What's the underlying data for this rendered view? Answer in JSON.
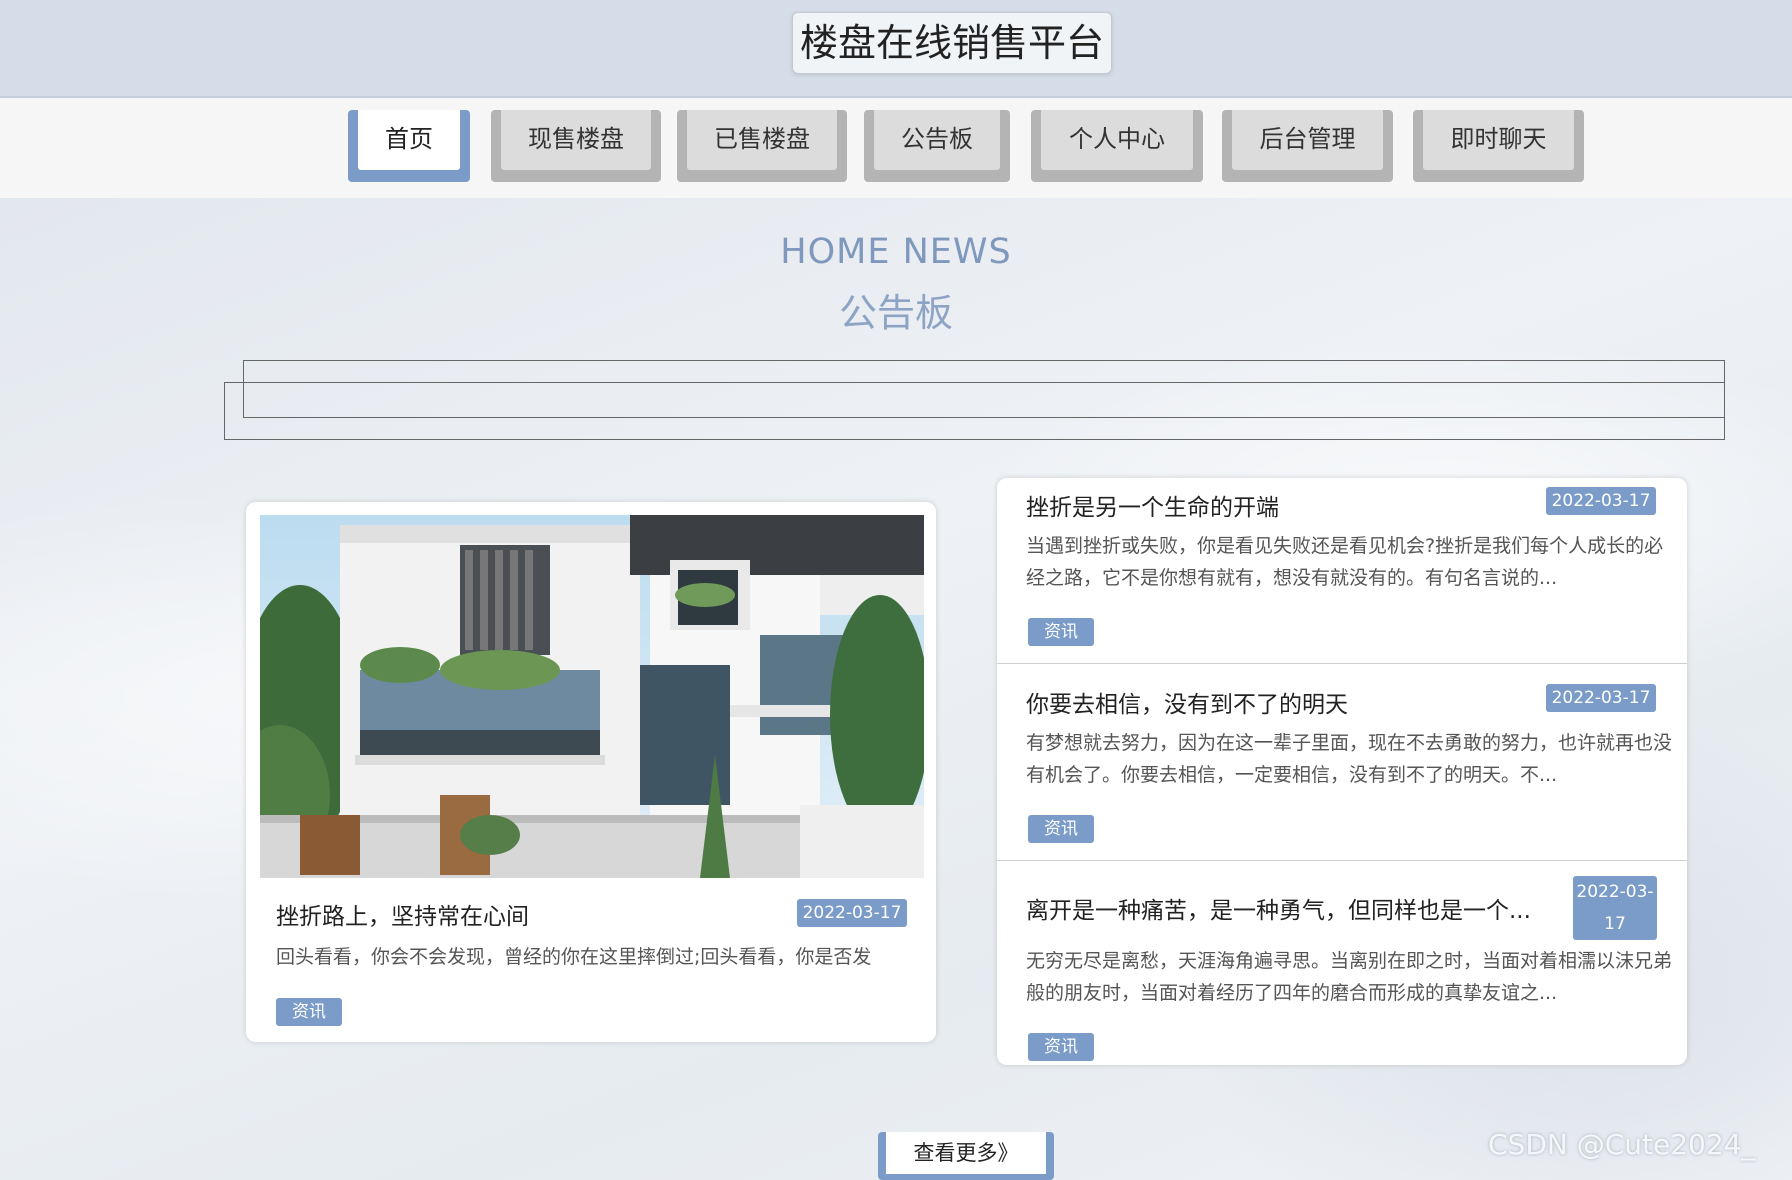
{
  "header": {
    "title": "楼盘在线销售平台"
  },
  "nav": {
    "items": [
      {
        "label": "首页"
      },
      {
        "label": "现售楼盘"
      },
      {
        "label": "已售楼盘"
      },
      {
        "label": "公告板"
      },
      {
        "label": "个人中心"
      },
      {
        "label": "后台管理"
      },
      {
        "label": "即时聊天"
      }
    ],
    "active_index": 0
  },
  "section": {
    "title_en": "HOME NEWS",
    "title_cn": "公告板"
  },
  "featured": {
    "title": "挫折路上，坚持常在心间",
    "date": "2022-03-17",
    "summary": "回头看看，你会不会发现，曾经的你在这里摔倒过;回头看看，你是否发",
    "tag": "资讯"
  },
  "news": [
    {
      "title": "挫折是另一个生命的开端",
      "date": "2022-03-17",
      "summary": "当遇到挫折或失败，你是看见失败还是看见机会?挫折是我们每个人成长的必经之路，它不是你想有就有，想没有就没有的。有句名言说的...",
      "tag": "资讯"
    },
    {
      "title": "你要去相信，没有到不了的明天",
      "date": "2022-03-17",
      "summary": "有梦想就去努力，因为在这一辈子里面，现在不去勇敢的努力，也许就再也没有机会了。你要去相信，一定要相信，没有到不了的明天。不...",
      "tag": "资讯"
    },
    {
      "title": "离开是一种痛苦，是一种勇气，但同样也是一个...",
      "date": "2022-03-17",
      "summary": "无穷无尽是离愁，天涯海角遍寻思。当离别在即之时，当面对着相濡以沫兄弟般的朋友时，当面对着经历了四年的磨合而形成的真挚友谊之...",
      "tag": "资讯"
    }
  ],
  "more_button": {
    "label": "查看更多》"
  },
  "watermark": "CSDN @Cute2024_",
  "colors": {
    "accent": "#7b9cc8",
    "header_bg": "#d5dde8",
    "nav_tab": "#dcdcdc"
  }
}
